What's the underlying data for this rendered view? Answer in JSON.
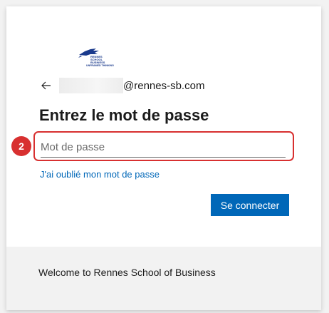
{
  "brand": {
    "logo_icon": "rennes-school-of-business-logo",
    "logo_text": [
      "RENNES",
      "SCHOOL",
      "BUSINESS",
      "UNFRAMED THINKING"
    ],
    "logo_color": "#1a3a8c"
  },
  "identity": {
    "back_icon": "back-arrow-icon",
    "email_domain": "@rennes-sb.com"
  },
  "form": {
    "title": "Entrez le mot de passe",
    "password_placeholder": "Mot de passe",
    "password_value": "",
    "forgot_link": "J'ai oublié mon mot de passe",
    "submit_label": "Se connecter"
  },
  "annotation": {
    "step_number": "2",
    "color": "#d83030"
  },
  "footer": {
    "text": "Welcome to Rennes School of Business"
  },
  "colors": {
    "accent": "#0067b8",
    "page_background": "#f2f2f2"
  }
}
